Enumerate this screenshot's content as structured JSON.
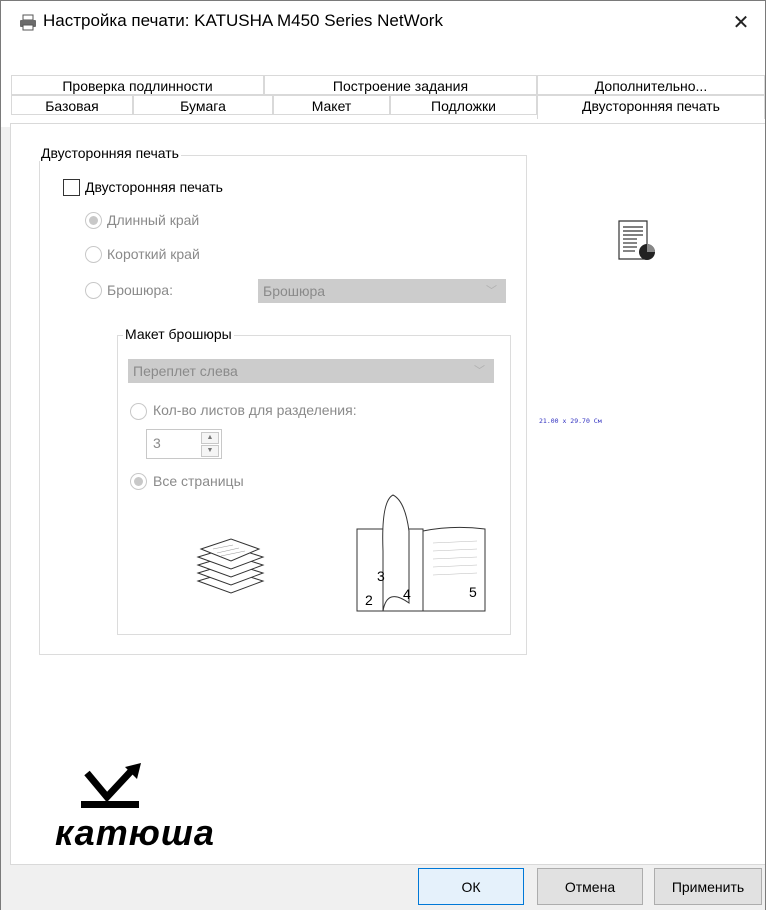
{
  "window": {
    "title": "Настройка печати: KATUSHA M450 Series NetWork",
    "close": "✕"
  },
  "tabs": {
    "row1": [
      "Проверка подлинности",
      "Построение задания",
      "Дополнительно..."
    ],
    "row2": [
      "Базовая",
      "Бумага",
      "Макет",
      "Подложки"
    ],
    "active": "Двусторонняя печать"
  },
  "duplex": {
    "group_label": "Двусторонняя печать",
    "checkbox_label": "Двусторонняя печать",
    "long_edge": "Длинный край",
    "short_edge": "Короткий край",
    "booklet": "Брошюра:",
    "booklet_select": "Брошюра"
  },
  "booklet_layout": {
    "group_label": "Макет брошюры",
    "binding_select": "Переплет слева",
    "sheets_label": "Кол-во листов для разделения:",
    "sheets_value": "3",
    "all_pages": "Все страницы",
    "page_numbers": [
      "2",
      "3",
      "4",
      "5"
    ]
  },
  "preview": {
    "dimensions": "21.00 x 29.70 См"
  },
  "logo": {
    "text": "катюша"
  },
  "buttons": {
    "ok": "ОК",
    "cancel": "Отмена",
    "apply": "Применить"
  }
}
